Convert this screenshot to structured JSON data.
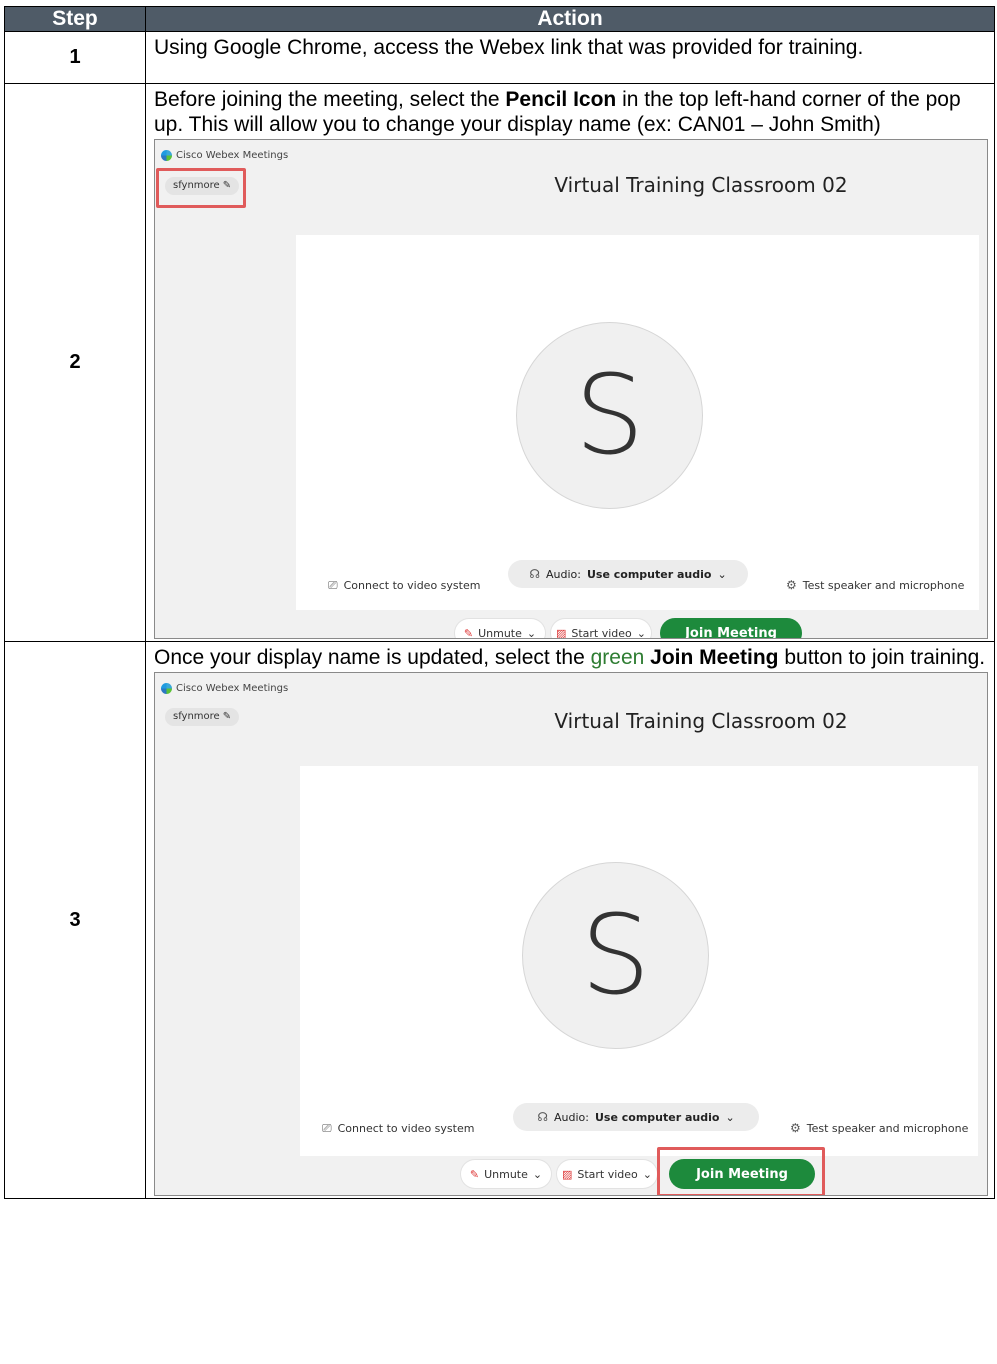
{
  "header": {
    "step": "Step",
    "action": "Action"
  },
  "rows": [
    {
      "step": "1",
      "text": "Using Google Chrome, access the Webex link that was provided for training."
    },
    {
      "step": "2",
      "text_a": "Before joining the meeting, select the ",
      "bold": "Pencil Icon",
      "text_b": " in the top left-hand corner of the pop up. This will allow you to change your display name (ex: CAN01 – John Smith)"
    },
    {
      "step": "3",
      "text_a": "Once your display name is updated, select the ",
      "green": "green",
      "bold": "Join Meeting",
      "text_b": " button to join training."
    }
  ],
  "webex": {
    "app_title": "Cisco Webex Meetings",
    "display_name": "sfynmore",
    "meeting_title": "Virtual Training Classroom 02",
    "avatar_letter": "S",
    "connect_video": "Connect to video system",
    "audio_label": "Audio:",
    "audio_value": "Use computer audio",
    "test_speaker": "Test speaker and microphone",
    "unmute": "Unmute",
    "start_video": "Start video",
    "join": "Join Meeting",
    "highlight_color": "#e05b5b",
    "join_color": "#1d8a3c"
  }
}
